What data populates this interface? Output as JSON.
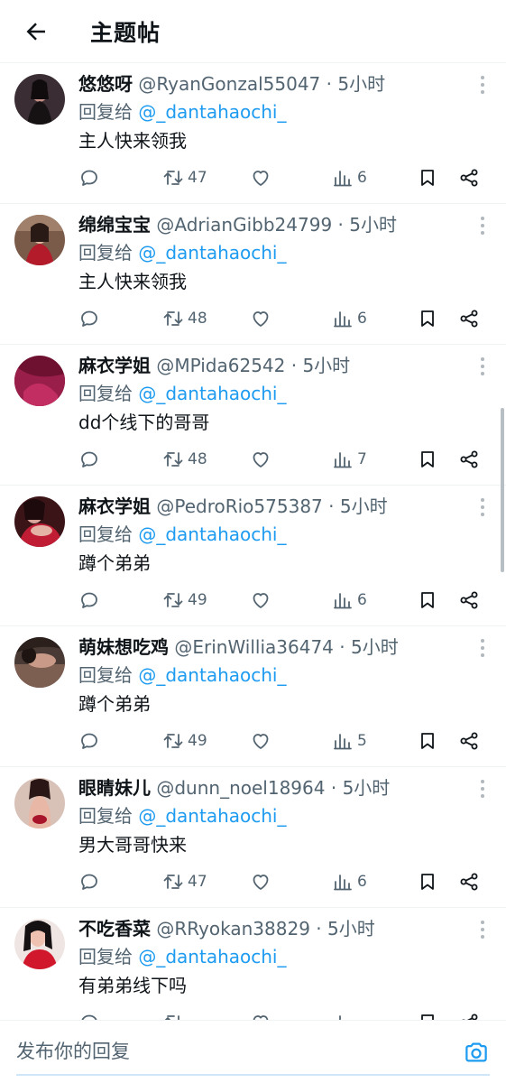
{
  "header": {
    "title": "主题帖",
    "back_icon": "arrow-left-icon"
  },
  "reply_prefix": "回复给",
  "colors": {
    "accent": "#1d9bf0",
    "secondary_text": "#536471",
    "divider": "#eff3f4"
  },
  "posts": [
    {
      "name": "悠悠呀",
      "handle": "@RyanGonzal55047",
      "time": "5小时",
      "reply_to": "@_dantahaochi_",
      "text": "主人快来领我",
      "reposts": "47",
      "views": "6"
    },
    {
      "name": "绵绵宝宝",
      "handle": "@AdrianGibb24799",
      "time": "5小时",
      "reply_to": "@_dantahaochi_",
      "text": "主人快来领我",
      "reposts": "48",
      "views": "6"
    },
    {
      "name": "麻衣学姐",
      "handle": "@MPida62542",
      "time": "5小时",
      "reply_to": "@_dantahaochi_",
      "text": "dd个线下的哥哥",
      "reposts": "48",
      "views": "7"
    },
    {
      "name": "麻衣学姐",
      "handle": "@PedroRio575387",
      "time": "5小时",
      "reply_to": "@_dantahaochi_",
      "text": "蹲个弟弟",
      "reposts": "49",
      "views": "6"
    },
    {
      "name": "萌妹想吃鸡",
      "handle": "@ErinWillia36474",
      "time": "5小时",
      "reply_to": "@_dantahaochi_",
      "text": "蹲个弟弟",
      "reposts": "49",
      "views": "5"
    },
    {
      "name": "眼睛妹儿",
      "handle": "@dunn_noel18964",
      "time": "5小时",
      "reply_to": "@_dantahaochi_",
      "text": "男大哥哥快来",
      "reposts": "47",
      "views": "6"
    },
    {
      "name": "不吃香菜",
      "handle": "@RRyokan38829",
      "time": "5小时",
      "reply_to": "@_dantahaochi_",
      "text": "有弟弟线下吗",
      "reposts": "",
      "views": ""
    }
  ],
  "compose": {
    "placeholder": "发布你的回复",
    "camera_icon": "camera-icon"
  }
}
